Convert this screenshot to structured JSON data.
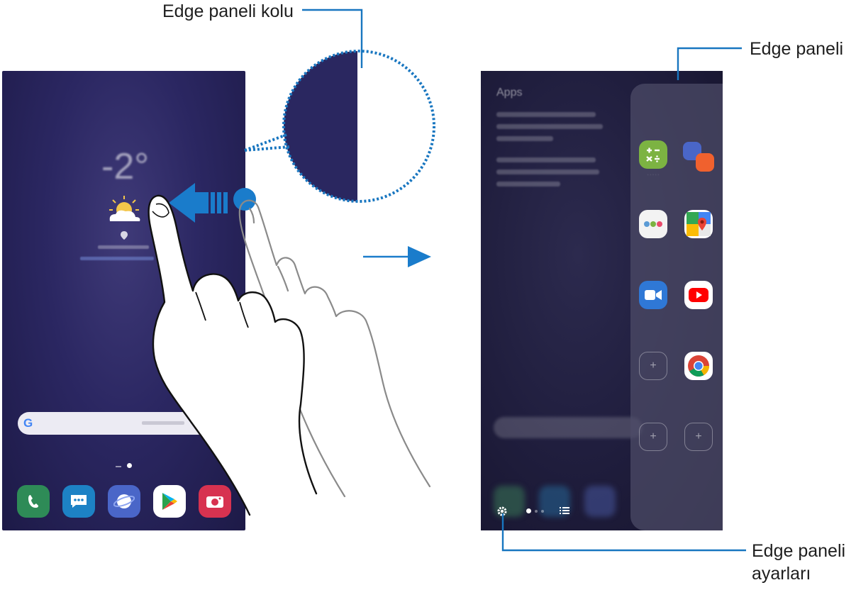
{
  "labels": {
    "edge_handle": "Edge paneli kolu",
    "edge_panel": "Edge paneli",
    "edge_settings_line1": "Edge paneli",
    "edge_settings_line2": "ayarları"
  },
  "left_phone": {
    "temperature": "-2°",
    "search_logo": "G",
    "dock_apps": [
      "phone-icon",
      "messages-icon",
      "internet-icon",
      "play-store-icon",
      "camera-icon"
    ]
  },
  "right_phone": {
    "panel_title": "Apps",
    "panel_apps": [
      "calculator-icon",
      "samsung-notes-icon",
      "folder-icon",
      "maps-icon",
      "duo-icon",
      "youtube-icon",
      "chrome-icon"
    ]
  },
  "colors": {
    "accent": "#1876c0",
    "arrow": "#1a7ccb",
    "phone_bg": "#2b2762",
    "phone_icon": "#2e8b57",
    "messages_icon": "#1d82c5",
    "internet_icon": "#4a66c8",
    "camera_icon": "#d73250",
    "calculator_icon": "#7cb342",
    "duo_icon": "#2f78d6",
    "youtube_icon": "#ff0000"
  }
}
